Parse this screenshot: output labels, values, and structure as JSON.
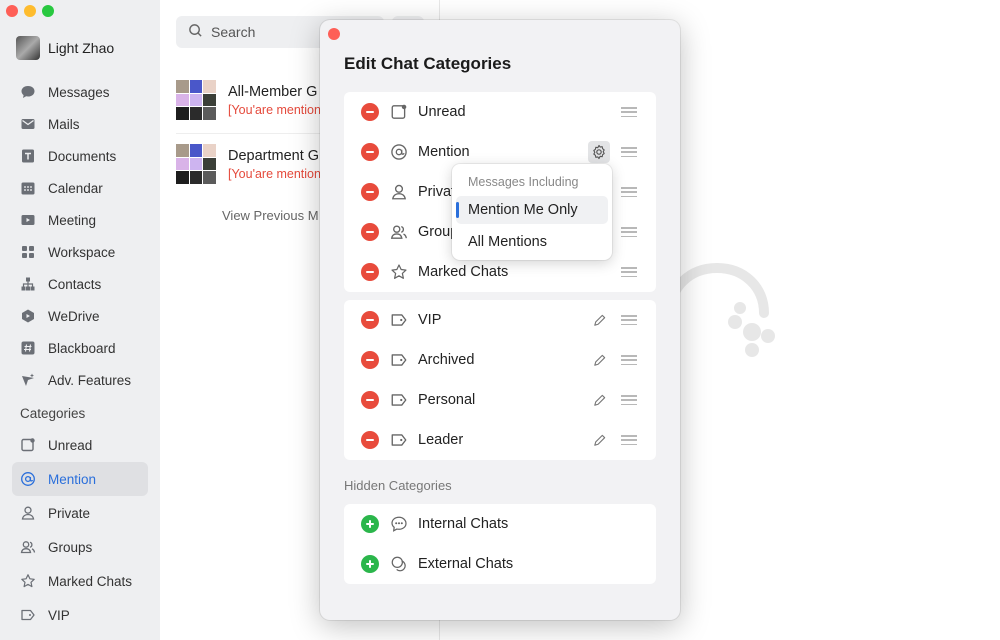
{
  "profile": {
    "name": "Light Zhao"
  },
  "nav": [
    {
      "label": "Messages",
      "icon": "chat-bubble-icon"
    },
    {
      "label": "Mails",
      "icon": "mail-icon"
    },
    {
      "label": "Documents",
      "icon": "document-icon"
    },
    {
      "label": "Calendar",
      "icon": "calendar-icon"
    },
    {
      "label": "Meeting",
      "icon": "video-icon"
    },
    {
      "label": "Workspace",
      "icon": "grid-icon"
    },
    {
      "label": "Contacts",
      "icon": "org-chart-icon"
    },
    {
      "label": "WeDrive",
      "icon": "drive-icon"
    },
    {
      "label": "Blackboard",
      "icon": "hash-icon"
    },
    {
      "label": "Adv. Features",
      "icon": "sparkle-icon"
    }
  ],
  "categories_title": "Categories",
  "categories": [
    {
      "label": "Unread",
      "icon": "unread-icon"
    },
    {
      "label": "Mention",
      "icon": "at-icon",
      "active": true
    },
    {
      "label": "Private",
      "icon": "person-icon"
    },
    {
      "label": "Groups",
      "icon": "people-icon"
    },
    {
      "label": "Marked Chats",
      "icon": "star-icon"
    },
    {
      "label": "VIP",
      "icon": "tag-icon"
    }
  ],
  "search": {
    "placeholder": "Search"
  },
  "chats": [
    {
      "name": "All-Member G",
      "subtitle": "[You'are mention"
    },
    {
      "name": "Department G",
      "subtitle": "[You'are mention"
    }
  ],
  "view_previous": "View Previous M",
  "modal": {
    "title": "Edit Chat Categories",
    "system_categories": [
      {
        "label": "Unread",
        "icon": "unread-icon"
      },
      {
        "label": "Mention",
        "icon": "at-icon",
        "has_settings": true
      },
      {
        "label": "Private",
        "icon": "person-icon"
      },
      {
        "label": "Groups",
        "icon": "people-icon"
      },
      {
        "label": "Marked Chats",
        "icon": "star-icon"
      }
    ],
    "custom_categories": [
      {
        "label": "VIP",
        "icon": "tag-icon"
      },
      {
        "label": "Archived",
        "icon": "tag-icon"
      },
      {
        "label": "Personal",
        "icon": "tag-icon"
      },
      {
        "label": "Leader",
        "icon": "tag-icon"
      }
    ],
    "hidden_title": "Hidden Categories",
    "hidden_categories": [
      {
        "label": "Internal Chats",
        "icon": "chat-dots-icon"
      },
      {
        "label": "External Chats",
        "icon": "chat-double-icon"
      }
    ]
  },
  "popup": {
    "heading": "Messages Including",
    "options": [
      {
        "label": "Mention Me Only",
        "selected": true
      },
      {
        "label": "All Mentions",
        "selected": false
      }
    ]
  },
  "colors": {
    "accent": "#2a6fdb",
    "remove": "#e84b3c",
    "add": "#2bb64b",
    "mention_text": "#e54a3c"
  }
}
